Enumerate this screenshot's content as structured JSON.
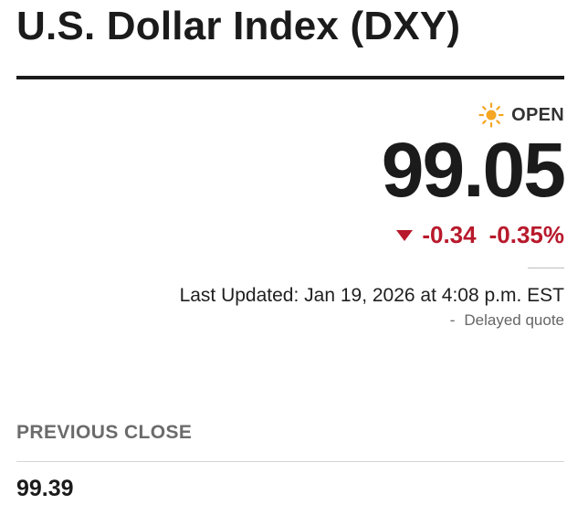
{
  "header": {
    "title": "U.S. Dollar Index (DXY)"
  },
  "quote": {
    "market_status": "OPEN",
    "market_status_icon": "sun-icon",
    "price": "99.05",
    "change": "-0.34",
    "change_percent": "-0.35%",
    "direction_icon": "down-triangle-icon",
    "last_updated": "Last Updated: Jan 19, 2026 at 4:08 p.m. EST",
    "delayed_separator": "-",
    "delayed_label": "Delayed quote"
  },
  "previous_close": {
    "label": "PREVIOUS CLOSE",
    "value": "99.39"
  },
  "colors": {
    "negative": "#b8192c",
    "sun": "#f5a623",
    "text": "#1b1b1b",
    "muted": "#6b6b6b"
  }
}
